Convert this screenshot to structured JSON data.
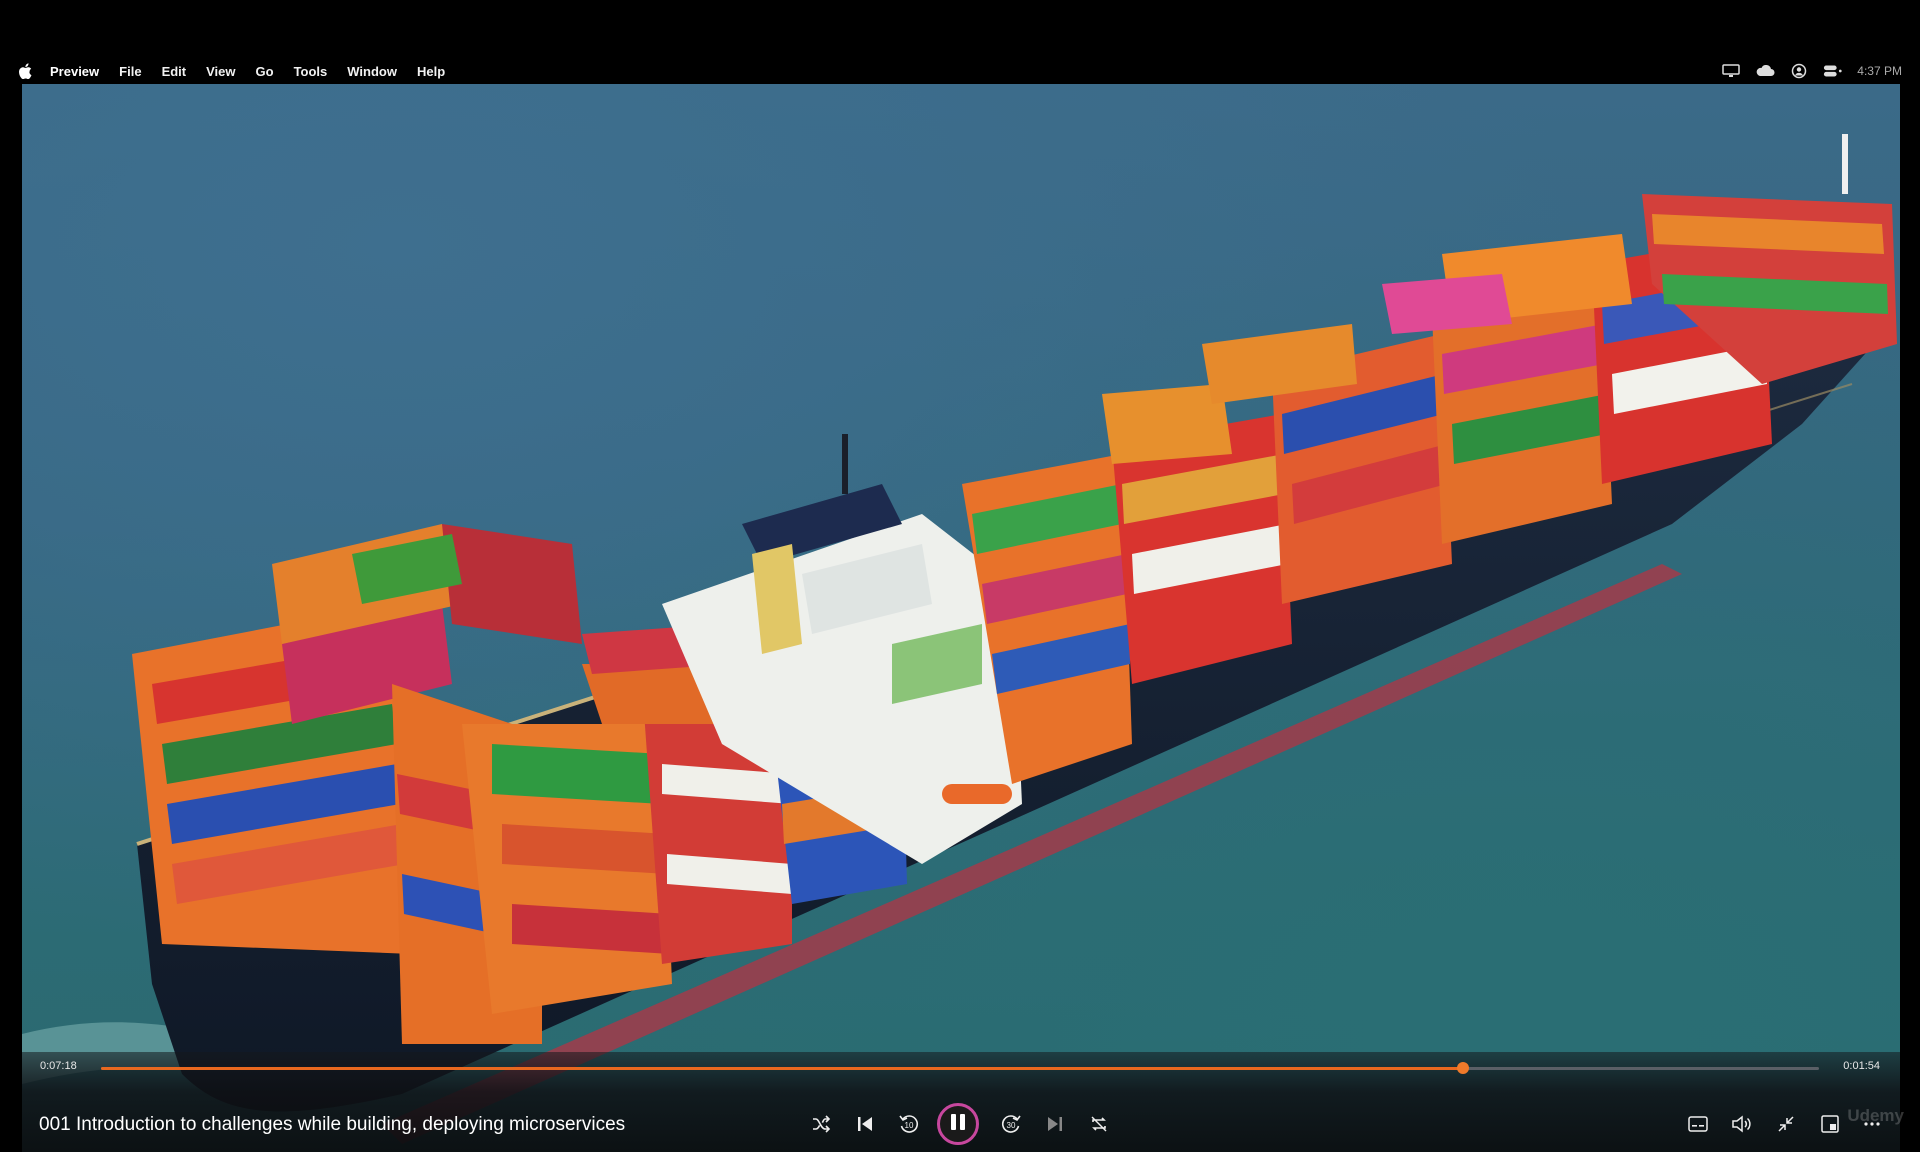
{
  "menubar": {
    "apple_icon": "apple-logo-icon",
    "app_name": "Preview",
    "items": [
      "File",
      "Edit",
      "View",
      "Go",
      "Tools",
      "Window",
      "Help"
    ],
    "status_icons": [
      "display-icon",
      "cloud-icon",
      "user-account-icon",
      "control-center-icon"
    ],
    "clock": "4:37 PM"
  },
  "player": {
    "elapsed": "0:07:18",
    "remaining": "0:01:54",
    "progress_fraction": 0.793,
    "title": "001 Introduction to challenges while building, deploying microservices",
    "rewind_label": "10",
    "forward_label": "30",
    "watermark": "Udemy",
    "accent_color": "#e8681f",
    "play_ring_color": "#c7479e",
    "controls_left": [
      "shuffle-icon",
      "previous-icon",
      "rewind-10-icon",
      "pause-icon",
      "forward-30-icon",
      "next-icon",
      "repeat-off-icon"
    ],
    "controls_right": [
      "captions-icon",
      "volume-icon",
      "exit-fullscreen-icon",
      "mini-player-icon",
      "more-icon"
    ]
  }
}
